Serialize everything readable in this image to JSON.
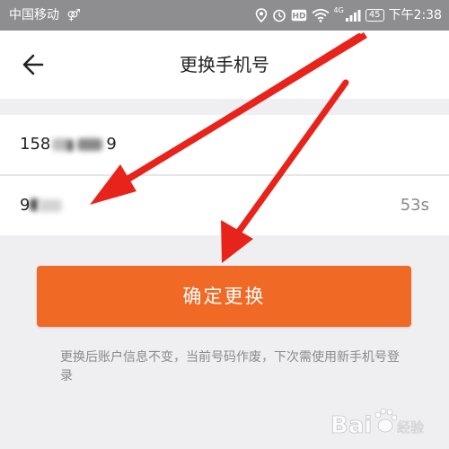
{
  "status_bar": {
    "carrier": "中国移动",
    "network": "4G",
    "battery": "45",
    "time": "下午2:38"
  },
  "header": {
    "title": "更换手机号",
    "back_icon": "back-arrow-icon"
  },
  "form": {
    "phone_value": "158",
    "phone_suffix": "9",
    "code_value": "9",
    "countdown": "53s"
  },
  "confirm_button": {
    "label": "确定更换"
  },
  "hint": "更换后账户信息不变，当前号码作废，下次需使用新手机号登录",
  "watermark": {
    "text": "Bai",
    "suffix": "经验"
  },
  "colors": {
    "accent": "#f06a25",
    "annotation_arrow": "#e8231b",
    "status_bar": "#8e8e90"
  }
}
